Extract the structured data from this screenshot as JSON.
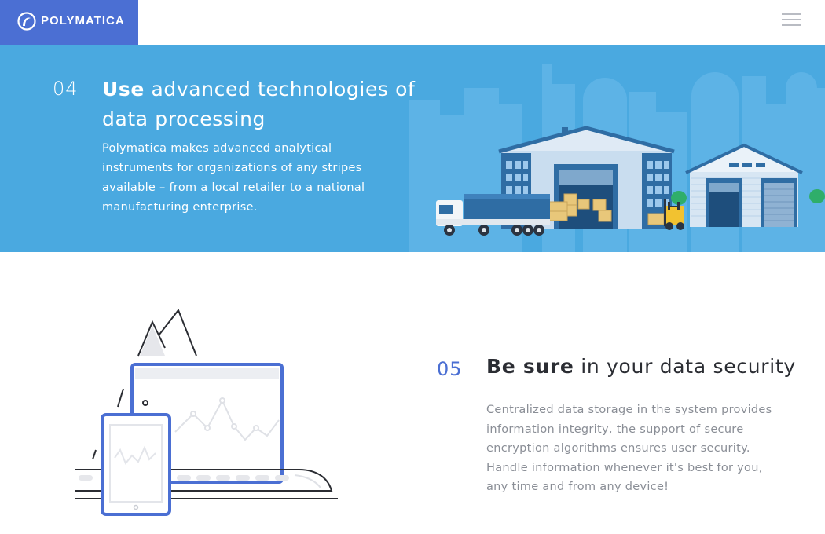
{
  "header": {
    "brand": "POLYMATICA",
    "menu_icon": "hamburger-menu-icon",
    "brand_color": "#4b6fd3"
  },
  "hero": {
    "number": "04",
    "title_bold": "Use",
    "title_rest": " advanced technologies of data processing",
    "description": "Polymatica makes advanced analytical instruments for organizations of any stripes available – from a local retailer to a national manufacturing enterprise.",
    "background_color": "#4aa9e0",
    "illustration": "warehouse-logistics-illustration"
  },
  "security": {
    "number": "05",
    "title_bold": "Be sure",
    "title_rest": " in your data security",
    "description": "Centralized data storage in the system provides information integrity, the support of secure encryption algorithms ensures user security. Handle information whenever it's best for you, any time and from any device!",
    "illustration": "devices-train-mountains-illustration"
  }
}
